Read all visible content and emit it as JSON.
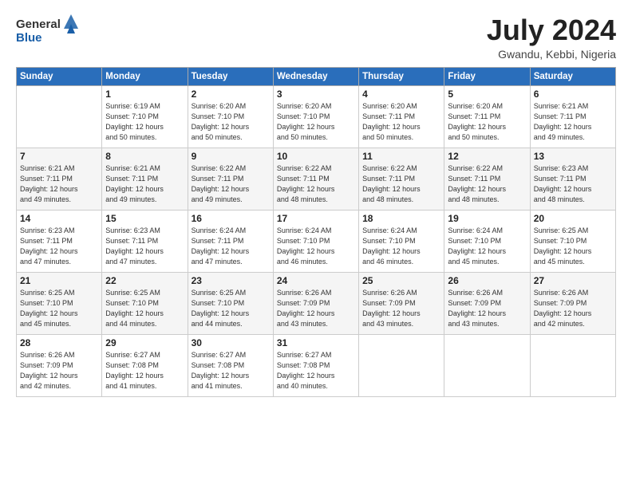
{
  "header": {
    "logo_general": "General",
    "logo_blue": "Blue",
    "month": "July 2024",
    "location": "Gwandu, Kebbi, Nigeria"
  },
  "days_of_week": [
    "Sunday",
    "Monday",
    "Tuesday",
    "Wednesday",
    "Thursday",
    "Friday",
    "Saturday"
  ],
  "weeks": [
    [
      {
        "day": "",
        "info": ""
      },
      {
        "day": "1",
        "info": "Sunrise: 6:19 AM\nSunset: 7:10 PM\nDaylight: 12 hours\nand 50 minutes."
      },
      {
        "day": "2",
        "info": "Sunrise: 6:20 AM\nSunset: 7:10 PM\nDaylight: 12 hours\nand 50 minutes."
      },
      {
        "day": "3",
        "info": "Sunrise: 6:20 AM\nSunset: 7:10 PM\nDaylight: 12 hours\nand 50 minutes."
      },
      {
        "day": "4",
        "info": "Sunrise: 6:20 AM\nSunset: 7:11 PM\nDaylight: 12 hours\nand 50 minutes."
      },
      {
        "day": "5",
        "info": "Sunrise: 6:20 AM\nSunset: 7:11 PM\nDaylight: 12 hours\nand 50 minutes."
      },
      {
        "day": "6",
        "info": "Sunrise: 6:21 AM\nSunset: 7:11 PM\nDaylight: 12 hours\nand 49 minutes."
      }
    ],
    [
      {
        "day": "7",
        "info": "Sunrise: 6:21 AM\nSunset: 7:11 PM\nDaylight: 12 hours\nand 49 minutes."
      },
      {
        "day": "8",
        "info": "Sunrise: 6:21 AM\nSunset: 7:11 PM\nDaylight: 12 hours\nand 49 minutes."
      },
      {
        "day": "9",
        "info": "Sunrise: 6:22 AM\nSunset: 7:11 PM\nDaylight: 12 hours\nand 49 minutes."
      },
      {
        "day": "10",
        "info": "Sunrise: 6:22 AM\nSunset: 7:11 PM\nDaylight: 12 hours\nand 48 minutes."
      },
      {
        "day": "11",
        "info": "Sunrise: 6:22 AM\nSunset: 7:11 PM\nDaylight: 12 hours\nand 48 minutes."
      },
      {
        "day": "12",
        "info": "Sunrise: 6:22 AM\nSunset: 7:11 PM\nDaylight: 12 hours\nand 48 minutes."
      },
      {
        "day": "13",
        "info": "Sunrise: 6:23 AM\nSunset: 7:11 PM\nDaylight: 12 hours\nand 48 minutes."
      }
    ],
    [
      {
        "day": "14",
        "info": "Sunrise: 6:23 AM\nSunset: 7:11 PM\nDaylight: 12 hours\nand 47 minutes."
      },
      {
        "day": "15",
        "info": "Sunrise: 6:23 AM\nSunset: 7:11 PM\nDaylight: 12 hours\nand 47 minutes."
      },
      {
        "day": "16",
        "info": "Sunrise: 6:24 AM\nSunset: 7:11 PM\nDaylight: 12 hours\nand 47 minutes."
      },
      {
        "day": "17",
        "info": "Sunrise: 6:24 AM\nSunset: 7:10 PM\nDaylight: 12 hours\nand 46 minutes."
      },
      {
        "day": "18",
        "info": "Sunrise: 6:24 AM\nSunset: 7:10 PM\nDaylight: 12 hours\nand 46 minutes."
      },
      {
        "day": "19",
        "info": "Sunrise: 6:24 AM\nSunset: 7:10 PM\nDaylight: 12 hours\nand 45 minutes."
      },
      {
        "day": "20",
        "info": "Sunrise: 6:25 AM\nSunset: 7:10 PM\nDaylight: 12 hours\nand 45 minutes."
      }
    ],
    [
      {
        "day": "21",
        "info": "Sunrise: 6:25 AM\nSunset: 7:10 PM\nDaylight: 12 hours\nand 45 minutes."
      },
      {
        "day": "22",
        "info": "Sunrise: 6:25 AM\nSunset: 7:10 PM\nDaylight: 12 hours\nand 44 minutes."
      },
      {
        "day": "23",
        "info": "Sunrise: 6:25 AM\nSunset: 7:10 PM\nDaylight: 12 hours\nand 44 minutes."
      },
      {
        "day": "24",
        "info": "Sunrise: 6:26 AM\nSunset: 7:09 PM\nDaylight: 12 hours\nand 43 minutes."
      },
      {
        "day": "25",
        "info": "Sunrise: 6:26 AM\nSunset: 7:09 PM\nDaylight: 12 hours\nand 43 minutes."
      },
      {
        "day": "26",
        "info": "Sunrise: 6:26 AM\nSunset: 7:09 PM\nDaylight: 12 hours\nand 43 minutes."
      },
      {
        "day": "27",
        "info": "Sunrise: 6:26 AM\nSunset: 7:09 PM\nDaylight: 12 hours\nand 42 minutes."
      }
    ],
    [
      {
        "day": "28",
        "info": "Sunrise: 6:26 AM\nSunset: 7:09 PM\nDaylight: 12 hours\nand 42 minutes."
      },
      {
        "day": "29",
        "info": "Sunrise: 6:27 AM\nSunset: 7:08 PM\nDaylight: 12 hours\nand 41 minutes."
      },
      {
        "day": "30",
        "info": "Sunrise: 6:27 AM\nSunset: 7:08 PM\nDaylight: 12 hours\nand 41 minutes."
      },
      {
        "day": "31",
        "info": "Sunrise: 6:27 AM\nSunset: 7:08 PM\nDaylight: 12 hours\nand 40 minutes."
      },
      {
        "day": "",
        "info": ""
      },
      {
        "day": "",
        "info": ""
      },
      {
        "day": "",
        "info": ""
      }
    ]
  ]
}
